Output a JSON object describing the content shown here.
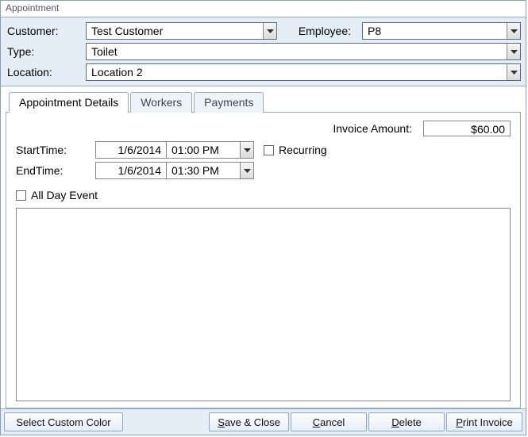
{
  "title": "Appointment",
  "header": {
    "customer_label": "Customer:",
    "customer_value": "Test Customer",
    "employee_label": "Employee:",
    "employee_value": "P8",
    "type_label": "Type:",
    "type_value": "Toilet",
    "location_label": "Location:",
    "location_value": "Location 2"
  },
  "tabs": {
    "details": "Appointment Details",
    "workers": "Workers",
    "payments": "Payments"
  },
  "details": {
    "invoice_label": "Invoice Amount:",
    "invoice_value": "$60.00",
    "start_label": "StartTime:",
    "start_date": "1/6/2014",
    "start_time": "01:00 PM",
    "end_label": "EndTime:",
    "end_date": "1/6/2014",
    "end_time": "01:30 PM",
    "recurring_label": "Recurring",
    "allday_label": "All Day Event"
  },
  "buttons": {
    "color": "Select Custom Color",
    "save_p": "S",
    "save_s": "ave & Close",
    "cancel_p": "C",
    "cancel_s": "ancel",
    "delete_p": "D",
    "delete_s": "elete",
    "print_p": "P",
    "print_s": "rint Invoice"
  }
}
